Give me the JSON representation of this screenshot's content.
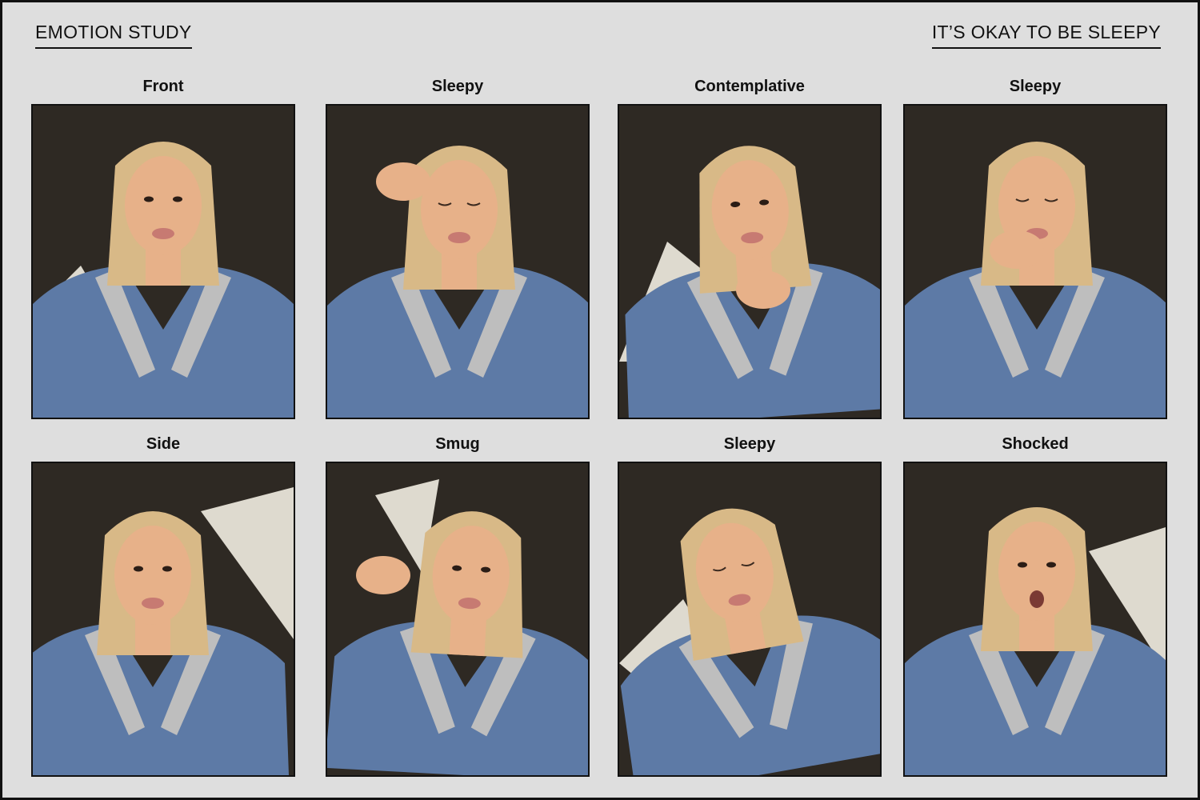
{
  "header": {
    "left_title": "EMOTION STUDY",
    "right_title": "IT’S OKAY TO BE SLEEPY"
  },
  "colors": {
    "background": "#dedede",
    "border": "#111111",
    "wall": "#2e2923",
    "light": "#f2ede2",
    "hair": "#d8b987",
    "skin": "#e7b189",
    "shirt": "#5d7aa6",
    "lace": "#cfcac2"
  },
  "photos": [
    {
      "label": "Front",
      "pose": "front"
    },
    {
      "label": "Sleepy",
      "pose": "sleepy-hand-eye"
    },
    {
      "label": "Contemplative",
      "pose": "contemplative"
    },
    {
      "label": "Sleepy",
      "pose": "sleepy-yawn"
    },
    {
      "label": "Side",
      "pose": "side"
    },
    {
      "label": "Smug",
      "pose": "smug-thumbs-up"
    },
    {
      "label": "Sleepy",
      "pose": "sleepy-tilt"
    },
    {
      "label": "Shocked",
      "pose": "shocked"
    }
  ]
}
